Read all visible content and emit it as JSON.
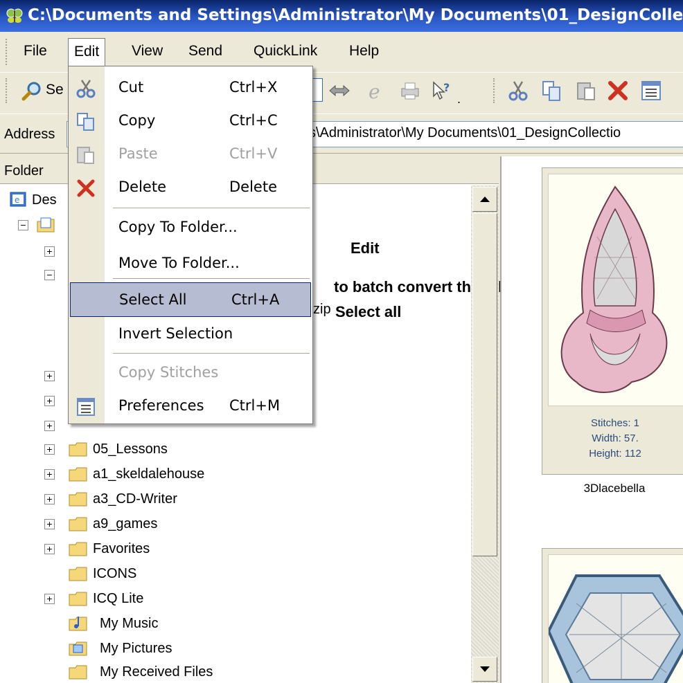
{
  "window": {
    "title": "C:\\Documents and Settings\\Administrator\\My Documents\\01_DesignColle",
    "app_icon": "butterfly-app-icon"
  },
  "menubar": {
    "items": [
      {
        "label": "File"
      },
      {
        "label": "Edit"
      },
      {
        "label": "View"
      },
      {
        "label": "Send"
      },
      {
        "label": "QuickLink"
      },
      {
        "label": "Help"
      }
    ]
  },
  "toolbar": {
    "search_fragment": "Se",
    "buttons": [
      "search-icon",
      "swap-arrows-icon",
      "browser-icon",
      "print-icon",
      "help-pointer-icon",
      "cut-icon",
      "copy-icon",
      "paste-icon",
      "delete-icon",
      "properties-icon"
    ]
  },
  "address": {
    "label": "Address",
    "path": "s\\Administrator\\My Documents\\01_DesignCollectio"
  },
  "folder_pane": {
    "header": "Folder",
    "root_label": "Des",
    "zip_fragment": "zip",
    "items": [
      {
        "label": "05_Lessons",
        "expandable": true
      },
      {
        "label": "a1_skeldalehouse",
        "expandable": true
      },
      {
        "label": "a3_CD-Writer",
        "expandable": true
      },
      {
        "label": "a9_games",
        "expandable": true
      },
      {
        "label": "Favorites",
        "expandable": true
      },
      {
        "label": "ICONS",
        "expandable": false
      },
      {
        "label": "ICQ Lite",
        "expandable": true
      },
      {
        "label": "My Music",
        "expandable": false
      },
      {
        "label": "My Pictures",
        "expandable": false
      },
      {
        "label": "My Received Files",
        "expandable": false
      }
    ]
  },
  "annotation": {
    "line1": "Edit",
    "line2": "to batch convert the  folder",
    "line3": "Select all"
  },
  "edit_menu": {
    "items": [
      {
        "label": "Cut",
        "shortcut": "Ctrl+X",
        "icon": "scissors-icon",
        "enabled": true
      },
      {
        "label": "Copy",
        "shortcut": "Ctrl+C",
        "icon": "copy-icon",
        "enabled": true
      },
      {
        "label": "Paste",
        "shortcut": "Ctrl+V",
        "icon": "paste-icon",
        "enabled": false
      },
      {
        "label": "Delete",
        "shortcut": "Delete",
        "icon": "red-x-icon",
        "enabled": true
      },
      {
        "label": "Copy To Folder...",
        "shortcut": "",
        "enabled": true
      },
      {
        "label": "Move To Folder...",
        "shortcut": "",
        "enabled": true
      },
      {
        "label": "Select All",
        "shortcut": "Ctrl+A",
        "enabled": true,
        "selected": true
      },
      {
        "label": "Invert Selection",
        "shortcut": "",
        "enabled": true
      },
      {
        "label": "Copy Stitches",
        "shortcut": "",
        "enabled": false
      },
      {
        "label": "Preferences",
        "shortcut": "Ctrl+M",
        "icon": "preferences-icon",
        "enabled": true
      }
    ]
  },
  "preview": {
    "card1": {
      "stitches": "Stitches: 1",
      "width": "Width: 57.",
      "height": "Height: 112",
      "caption": "3Dlacebella"
    }
  },
  "colors": {
    "titlebar": "#0a246a",
    "menu_highlight": "#b6bdd2",
    "info_text": "#2b4b7c"
  }
}
